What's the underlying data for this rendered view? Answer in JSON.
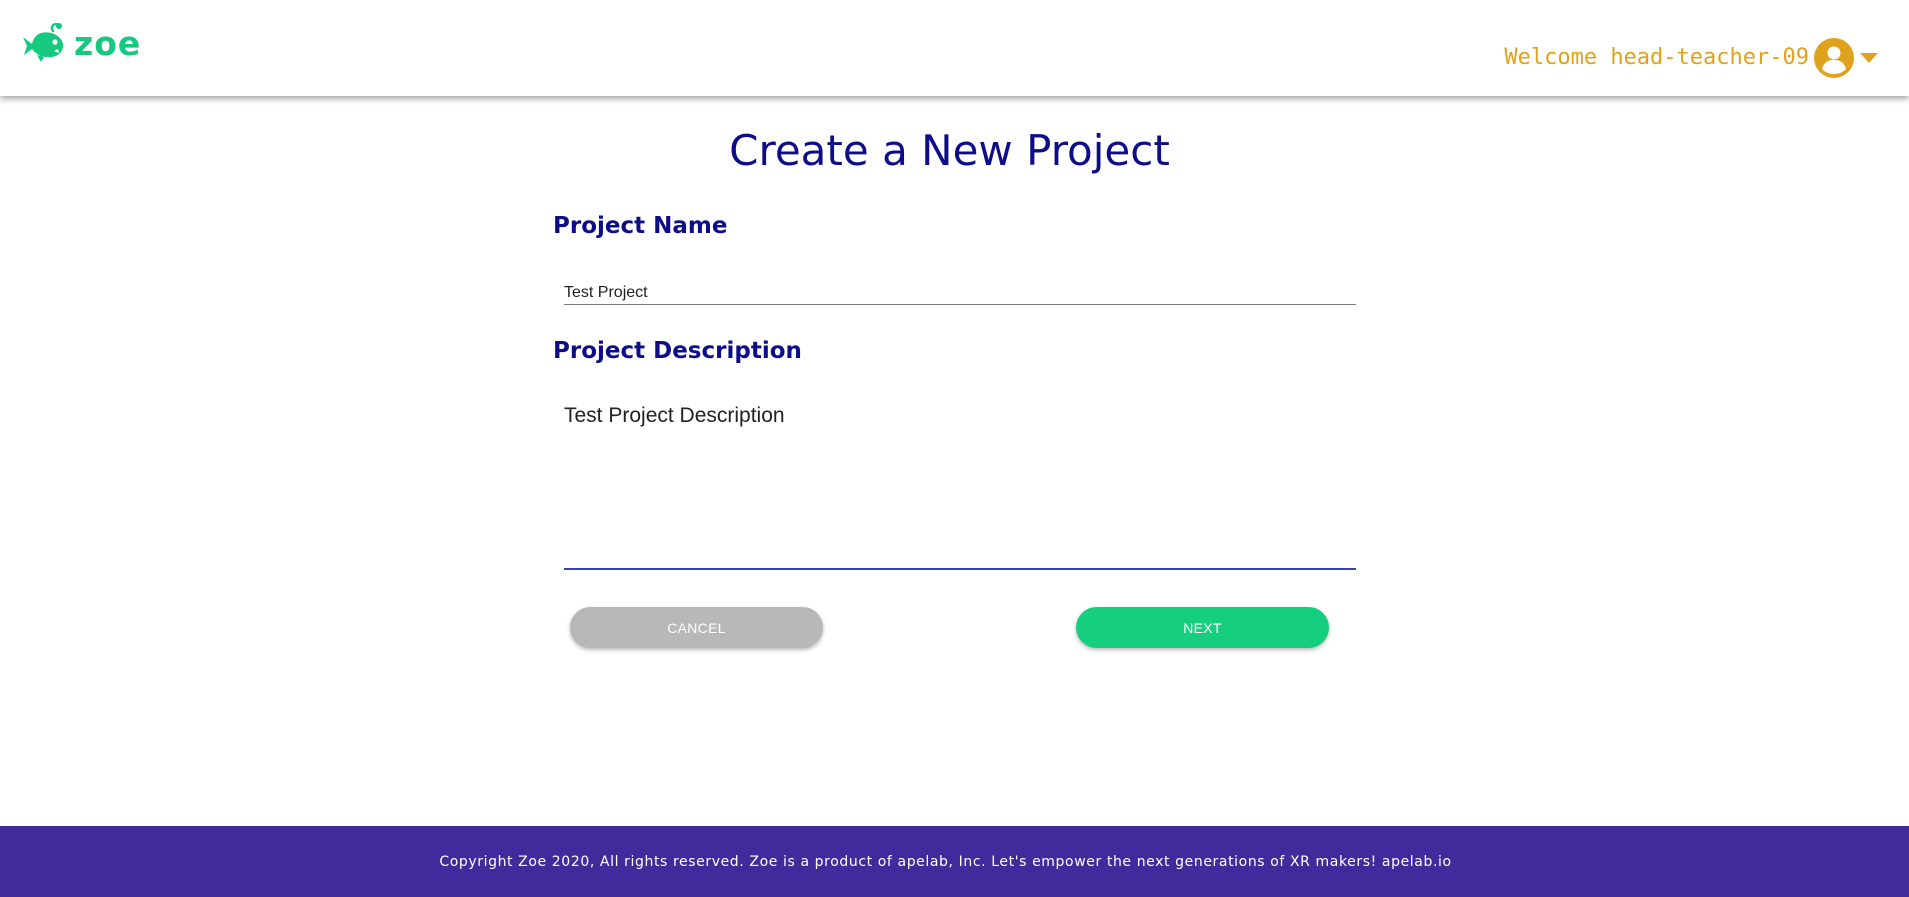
{
  "header": {
    "logo_text": "zoe",
    "welcome_text": "Welcome head-teacher-09",
    "brand_color": "#15c97e",
    "accent_color": "#dfa21d",
    "icons": {
      "logo": "fish-logo-icon",
      "avatar": "user-avatar-icon",
      "caret": "caret-down-icon"
    }
  },
  "main": {
    "title": "Create a New Project",
    "project_name": {
      "label": "Project Name",
      "value": "Test Project"
    },
    "project_description": {
      "label": "Project Description",
      "value": "Test Project Description"
    },
    "buttons": {
      "cancel": "CANCEL",
      "next": "NEXT"
    },
    "title_color": "#0d0d8a"
  },
  "footer": {
    "text": "Copyright Zoe 2020, All rights reserved. Zoe is a product of apelab, Inc. Let's empower the next generations of XR makers! apelab.io",
    "background_color": "#412b9c"
  }
}
